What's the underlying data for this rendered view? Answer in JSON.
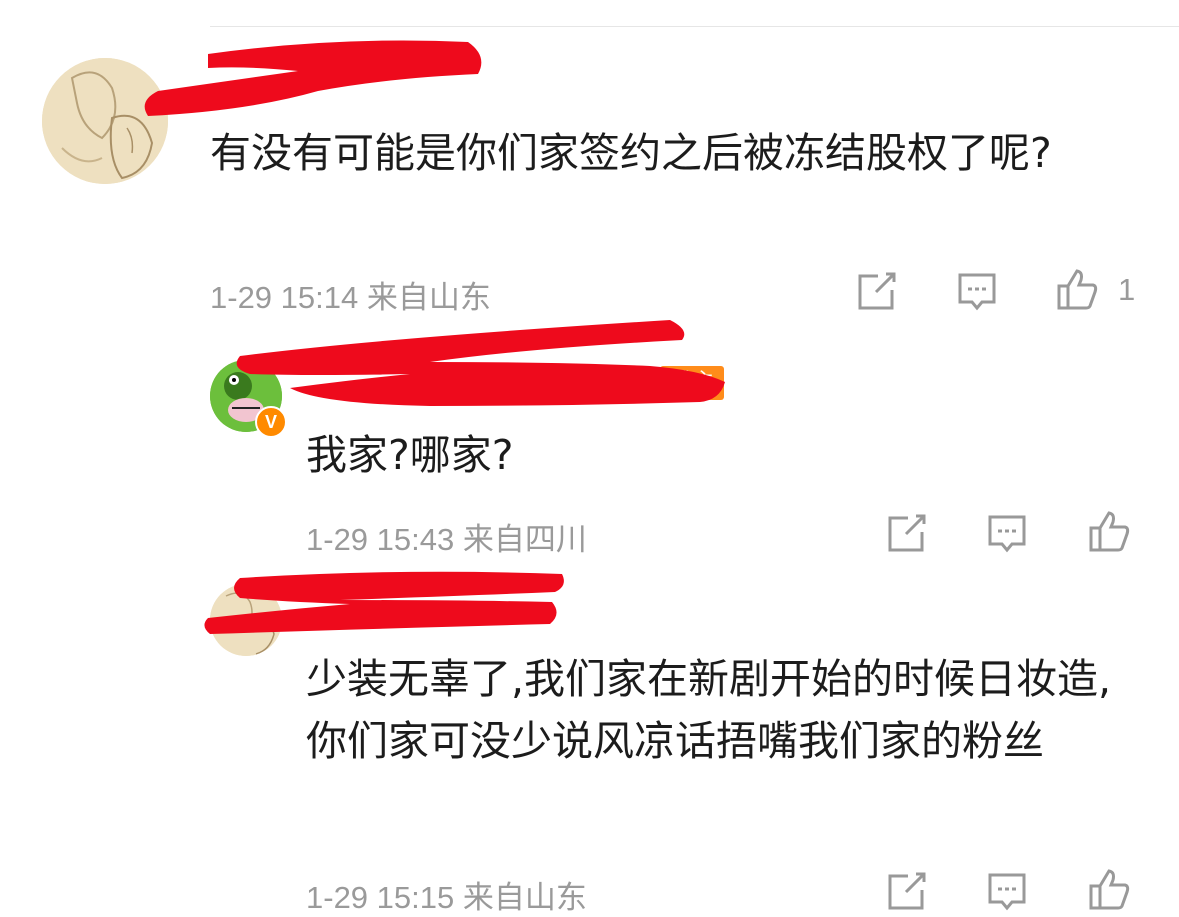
{
  "comments": [
    {
      "text": "有没有可能是你们家签约之后被冻结股权了呢?",
      "meta": "1-29 15:14 来自山东",
      "likes": "1"
    },
    {
      "badge": "博主",
      "text": "我家?哪家?",
      "meta": "1-29 15:43 来自四川",
      "likes": ""
    },
    {
      "text": "少装无辜了,我们家在新剧开始的时候日妆造,你们家可没少说风凉话捂嘴我们家的粉丝",
      "meta": "1-29 15:15 来自山东",
      "likes": ""
    }
  ],
  "icons": {
    "share": "share-icon",
    "comment": "comment-icon",
    "like": "thumbs-up-icon",
    "verified": "verified-v-icon"
  },
  "colors": {
    "redaction": "#ee0a1c",
    "meta": "#9a9a9a",
    "badge": "#ff8c1a"
  }
}
